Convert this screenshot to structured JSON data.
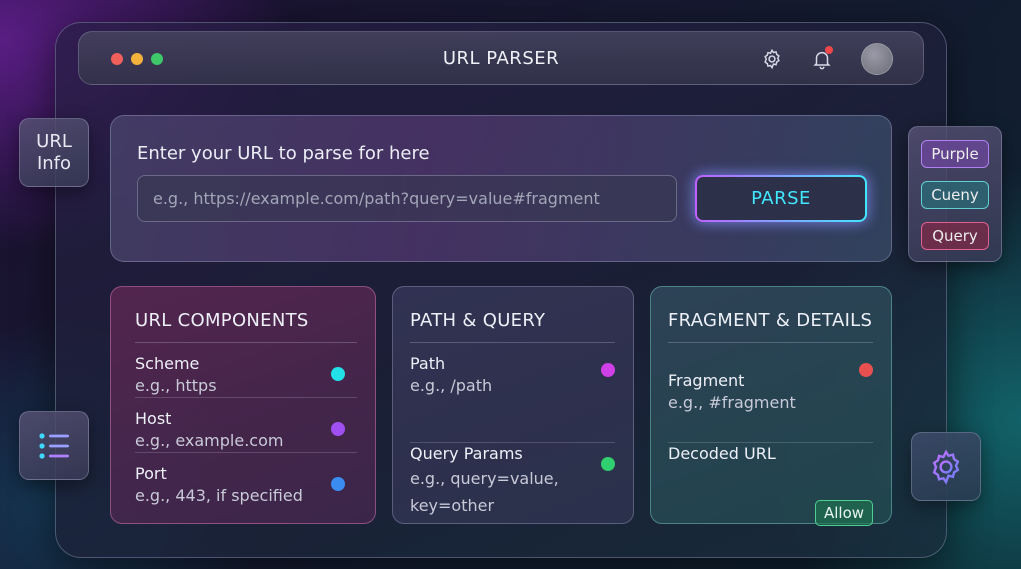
{
  "app": {
    "title": "URL PARSER"
  },
  "header": {
    "settings_icon": "gear-icon",
    "notifications_icon": "bell-icon",
    "notification_dot_color": "#f0484a",
    "avatar": "user-avatar"
  },
  "sidebar_left": {
    "url_info_line1": "URL",
    "url_info_line2": "Info",
    "list_icon": "list-icon"
  },
  "sidebar_right": {
    "tags": [
      "Purple",
      "Cueny",
      "Query"
    ],
    "gear_icon": "gear-icon"
  },
  "input": {
    "label": "Enter your URL to parse for here",
    "placeholder": "e.g., https://example.com/path?query=value#fragment",
    "value": "",
    "button": "PARSE"
  },
  "cards": {
    "components": {
      "title": "URL COMPONENTS",
      "rows": [
        {
          "label": "Scheme",
          "value": "e.g., https",
          "color": "#22e0e8"
        },
        {
          "label": "Host",
          "value": "e.g., example.com",
          "color": "#a050f0"
        },
        {
          "label": "Port",
          "value": "e.g., 443, if specified",
          "color": "#3a8cf0"
        }
      ]
    },
    "path_query": {
      "title": "PATH & QUERY",
      "rows": [
        {
          "label": "Path",
          "value": "e.g., /path",
          "color": "#d040e8"
        },
        {
          "label": "Query Params",
          "value_line1": "e.g., query=value,",
          "value_line2": "key=other",
          "color": "#30d070"
        }
      ]
    },
    "fragment": {
      "title": "FRAGMENT & DETAILS",
      "rows": [
        {
          "label": "Fragment",
          "value": "e.g., #fragment",
          "color": "#e85050"
        },
        {
          "label": "Decoded URL",
          "button": "Allow"
        }
      ]
    }
  }
}
